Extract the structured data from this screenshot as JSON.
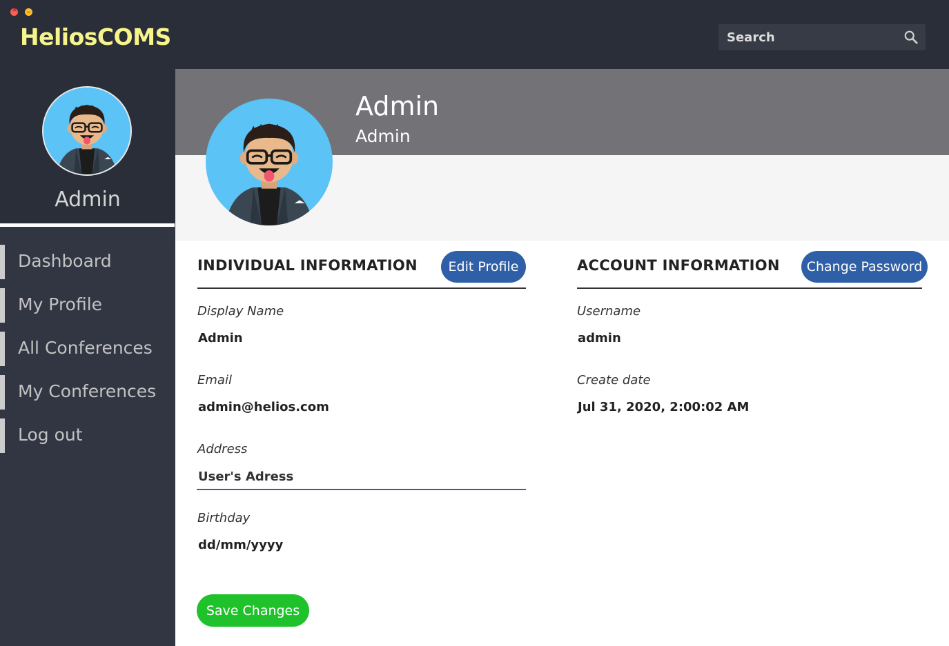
{
  "app": {
    "title": "HeliosCOMS"
  },
  "search": {
    "placeholder": "Search"
  },
  "sidebar": {
    "user_name": "Admin",
    "items": [
      {
        "label": "Dashboard"
      },
      {
        "label": "My Profile"
      },
      {
        "label": "All Conferences"
      },
      {
        "label": "My Conferences"
      },
      {
        "label": "Log out"
      }
    ]
  },
  "profile": {
    "name": "Admin",
    "role": "Admin"
  },
  "individual": {
    "heading": "INDIVIDUAL INFORMATION",
    "edit_label": "Edit Profile",
    "display_name_label": "Display Name",
    "display_name": "Admin",
    "email_label": "Email",
    "email": "admin@helios.com",
    "address_label": "Address",
    "address_value": "User's Adress",
    "birthday_label": "Birthday",
    "birthday": "dd/mm/yyyy"
  },
  "account": {
    "heading": "ACCOUNT INFORMATION",
    "change_password_label": "Change Password",
    "username_label": "Username",
    "username": "admin",
    "create_date_label": "Create date",
    "create_date": "Jul 31, 2020, 2:00:02 AM"
  },
  "actions": {
    "save_label": "Save Changes"
  },
  "colors": {
    "topbar": "#2a2e38",
    "sidebar": "#323643",
    "logo": "#f6f48a",
    "accent_blue": "#2f5fa6",
    "save_green": "#1fc22b",
    "banner": "#737377"
  }
}
